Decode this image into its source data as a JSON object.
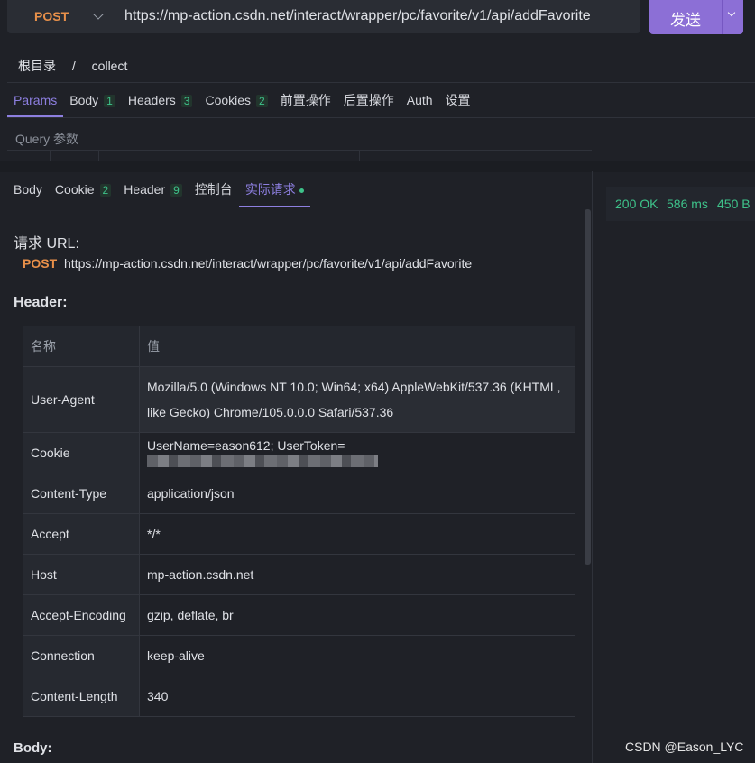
{
  "request": {
    "method": "POST",
    "url": "https://mp-action.csdn.net/interact/wrapper/pc/favorite/v1/api/addFavorite",
    "send_label": "发送"
  },
  "breadcrumb": {
    "root": "根目录",
    "sep": "/",
    "current": "collect"
  },
  "request_tabs": [
    {
      "label": "Params",
      "badge": ""
    },
    {
      "label": "Body",
      "badge": "1"
    },
    {
      "label": "Headers",
      "badge": "3"
    },
    {
      "label": "Cookies",
      "badge": "2"
    },
    {
      "label": "前置操作",
      "badge": ""
    },
    {
      "label": "后置操作",
      "badge": ""
    },
    {
      "label": "Auth",
      "badge": ""
    },
    {
      "label": "设置",
      "badge": ""
    }
  ],
  "query_label": "Query 参数",
  "response_tabs": [
    {
      "label": "Body",
      "badge": ""
    },
    {
      "label": "Cookie",
      "badge": "2"
    },
    {
      "label": "Header",
      "badge": "9"
    },
    {
      "label": "控制台",
      "badge": ""
    },
    {
      "label": "实际请求",
      "badge": ""
    }
  ],
  "status": {
    "code": "200 OK",
    "time": "586 ms",
    "size": "450 B"
  },
  "actual": {
    "url_title": "请求 URL:",
    "method": "POST",
    "url": "https://mp-action.csdn.net/interact/wrapper/pc/favorite/v1/api/addFavorite",
    "header_title": "Header:",
    "col_name": "名称",
    "col_value": "值",
    "headers": [
      {
        "name": "User-Agent",
        "value": "Mozilla/5.0 (Windows NT 10.0; Win64; x64) AppleWebKit/537.36 (KHTML, like Gecko) Chrome/105.0.0.0 Safari/537.36"
      },
      {
        "name": "Cookie",
        "value": "UserName=eason612; UserToken="
      },
      {
        "name": "Content-Type",
        "value": "application/json"
      },
      {
        "name": "Accept",
        "value": "*/*"
      },
      {
        "name": "Host",
        "value": "mp-action.csdn.net"
      },
      {
        "name": "Accept-Encoding",
        "value": "gzip, deflate, br"
      },
      {
        "name": "Connection",
        "value": "keep-alive"
      },
      {
        "name": "Content-Length",
        "value": "340"
      }
    ],
    "body_title": "Body:"
  },
  "watermark": "CSDN @Eason_LYC",
  "colors": {
    "accent": "#8d7fe0",
    "method": "#e8904a",
    "success": "#3ec28a",
    "send": "#8c6fd6"
  }
}
